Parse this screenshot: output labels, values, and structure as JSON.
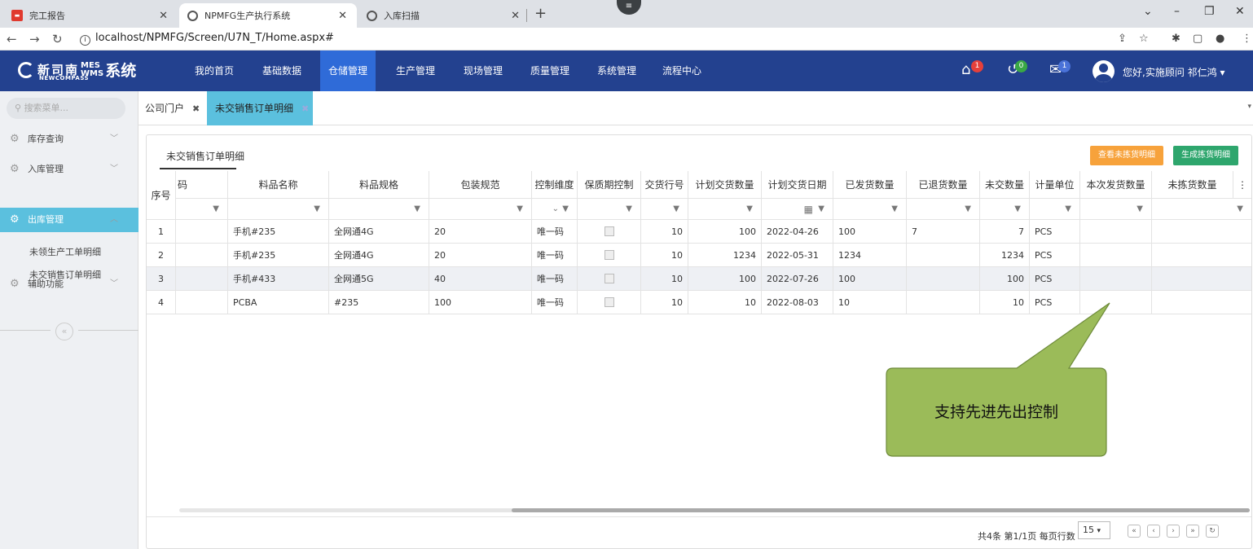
{
  "browser": {
    "tabs": [
      {
        "label": "完工报告",
        "favicon": "report-icon"
      },
      {
        "label": "NPMFG生产执行系统",
        "favicon": "globe-icon"
      },
      {
        "label": "入库扫描",
        "favicon": "globe-icon"
      }
    ],
    "url": "localhost/NPMFG/Screen/U7N_T/Home.aspx#"
  },
  "app": {
    "logo_cn": "新司南",
    "logo_en": "NEWCOMPASS",
    "logo_mes": "MES",
    "logo_wms": "WMS",
    "logo_suffix": "系统",
    "menu": [
      "我的首页",
      "基础数据",
      "仓储管理",
      "生产管理",
      "现场管理",
      "质量管理",
      "系统管理",
      "流程中心"
    ],
    "active_menu": "仓储管理",
    "badges": {
      "home": "1",
      "refresh": "0",
      "mail": "1"
    },
    "user_greeting": "您好,实施顾问 祁仁鸿"
  },
  "sidebar": {
    "search_placeholder": "搜索菜单...",
    "items": [
      {
        "label": "库存查询"
      },
      {
        "label": "入库管理"
      },
      {
        "label": "出库管理"
      },
      {
        "label": "辅助功能"
      }
    ],
    "subitems": [
      "未领生产工单明细",
      "未交销售订单明细"
    ],
    "collapse_glyph": "«"
  },
  "page_tabs": [
    {
      "label": "公司门户",
      "close": "✖"
    },
    {
      "label": "未交销售订单明细",
      "close": "✖"
    }
  ],
  "panel": {
    "title": "未交销售订单明细",
    "btn_view": "查看未拣货明细",
    "btn_generate": "生成拣货明细"
  },
  "grid": {
    "rownum_header": "序号",
    "columns": [
      "码",
      "料品名称",
      "料品规格",
      "包装规范",
      "控制维度",
      "保质期控制",
      "交货行号",
      "计划交货数量",
      "计划交货日期",
      "已发货数量",
      "已退货数量",
      "未交数量",
      "计量单位",
      "本次发货数量",
      "未拣货数量"
    ],
    "more_glyph": "⋮",
    "rows": [
      {
        "no": "1",
        "name": "手机#235",
        "spec": "全网通4G",
        "pack": "20",
        "dim": "唯一码",
        "line": "10",
        "qty": "100",
        "date": "2022-04-26",
        "shipped": "100",
        "returned": "7",
        "open": "7",
        "unit": "PCS"
      },
      {
        "no": "2",
        "name": "手机#235",
        "spec": "全网通4G",
        "pack": "20",
        "dim": "唯一码",
        "line": "10",
        "qty": "1234",
        "date": "2022-05-31",
        "shipped": "1234",
        "returned": "",
        "open": "1234",
        "unit": "PCS"
      },
      {
        "no": "3",
        "name": "手机#433",
        "spec": "全网通5G",
        "pack": "40",
        "dim": "唯一码",
        "line": "10",
        "qty": "100",
        "date": "2022-07-26",
        "shipped": "100",
        "returned": "",
        "open": "100",
        "unit": "PCS"
      },
      {
        "no": "4",
        "name": "PCBA",
        "spec": "#235",
        "pack": "100",
        "dim": "唯一码",
        "line": "10",
        "qty": "10",
        "date": "2022-08-03",
        "shipped": "10",
        "returned": "",
        "open": "10",
        "unit": "PCS"
      }
    ]
  },
  "pager": {
    "summary": "共4条 第1/1页 每页行数",
    "page_size": "15"
  },
  "callout": {
    "text": "支持先进先出控制",
    "color": "#9bbb59"
  }
}
